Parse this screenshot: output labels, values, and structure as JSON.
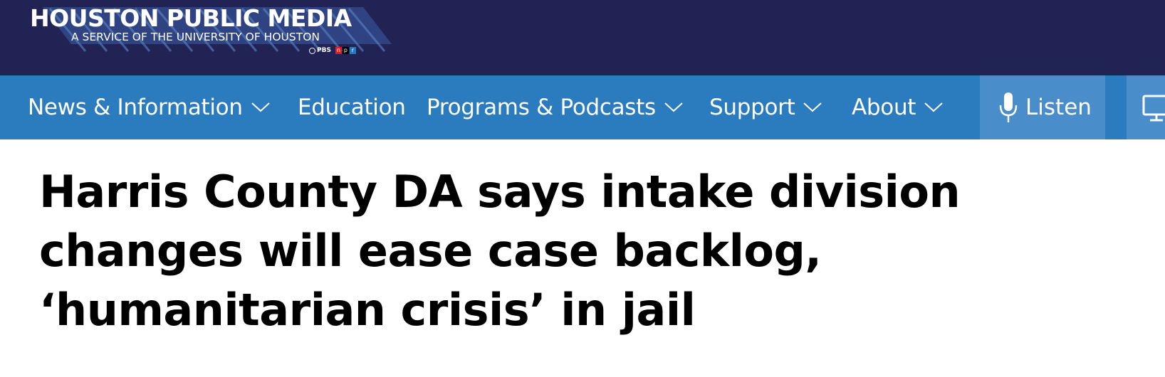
{
  "masthead": {
    "title": "HOUSTON PUBLIC MEDIA",
    "subtitle": "A SERVICE OF THE UNIVERSITY OF HOUSTON",
    "partners": {
      "pbs": "PBS",
      "npr_n": "n",
      "npr_p": "p",
      "npr_r": "r"
    },
    "background_color": "#222355"
  },
  "nav": {
    "background_color": "#2b7bbf",
    "items": [
      {
        "label": "News & Information",
        "has_dropdown": true
      },
      {
        "label": "Education",
        "has_dropdown": false
      },
      {
        "label": "Programs & Podcasts",
        "has_dropdown": true
      },
      {
        "label": "Support",
        "has_dropdown": true
      },
      {
        "label": "About",
        "has_dropdown": true
      }
    ],
    "listen": {
      "label": "Listen",
      "icon": "microphone-icon"
    },
    "watch": {
      "icon": "tv-icon"
    }
  },
  "article": {
    "headline": "Harris County DA says intake division changes will ease case backlog, ‘humanitarian crisis’ in jail"
  }
}
